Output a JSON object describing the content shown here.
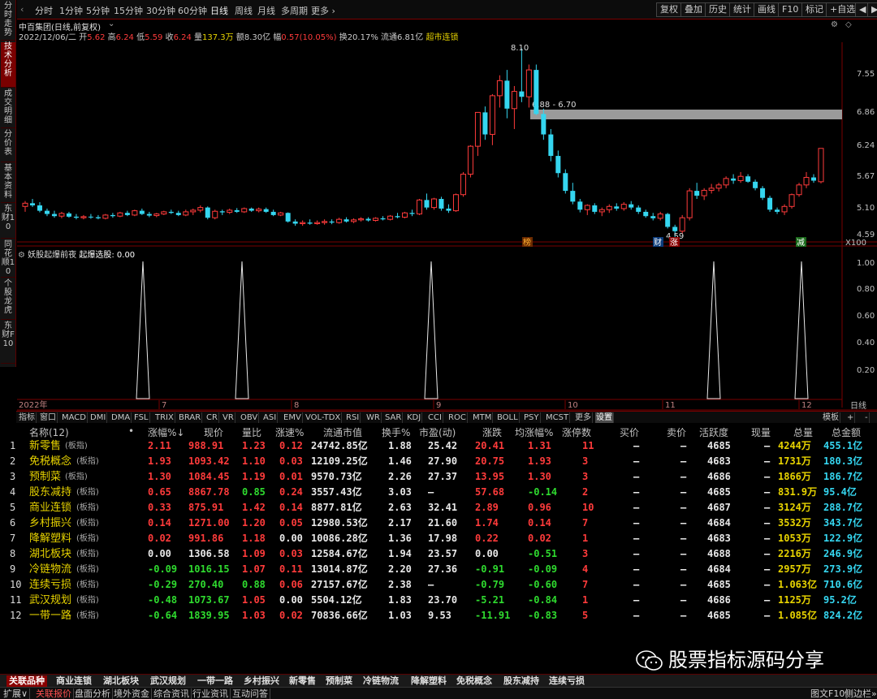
{
  "left_tabs": [
    "分时走势",
    "技术分析",
    "成交明细",
    "分价表",
    "基本资料",
    "东财10",
    "同花顺10",
    "个股龙虎",
    "东财F10"
  ],
  "periods": [
    "分时",
    "1分钟",
    "5分钟",
    "15分钟",
    "30分钟",
    "60分钟",
    "日线",
    "周线",
    "月线",
    "多周期",
    "更多 ›"
  ],
  "toolbar_right": [
    "复权",
    "叠加",
    "历史",
    "统计",
    "画线",
    "F10",
    "标记",
    "+自选",
    "◀",
    "▶"
  ],
  "stock": {
    "title": "中百集团(日线,前复权)",
    "date": "2022/12/06/二",
    "open_label": "开",
    "open": "5.62",
    "high_label": "高",
    "high": "6.24",
    "low_label": "低",
    "low": "5.59",
    "close_label": "收",
    "close": "6.24",
    "vol_label": "量",
    "vol": "137.3万",
    "amt_label": "额",
    "amt": "8.30亿",
    "chg_label": "幅",
    "chg": "0.57(10.05%)",
    "turn_label": "换",
    "turn": "20.17%",
    "float_label": "流通",
    "float": "6.81亿",
    "concept": "超市连锁"
  },
  "price_axis": [
    "7.55",
    "6.86",
    "6.24",
    "5.67",
    "5.10",
    "4.59",
    "X100"
  ],
  "annotations": {
    "high": "8.10",
    "zone": "6.88 - 6.70",
    "low": "4.59",
    "flag1": "榜",
    "flag2": "财",
    "flag3": "涨",
    "flag4": "减"
  },
  "candles": [
    [
      5.16,
      5.26,
      5.06,
      5.22
    ],
    [
      5.22,
      5.3,
      5.15,
      5.18
    ],
    [
      5.18,
      5.24,
      5.05,
      5.08
    ],
    [
      5.08,
      5.12,
      4.98,
      5.02
    ],
    [
      5.02,
      5.08,
      4.95,
      4.98
    ],
    [
      4.98,
      5.06,
      4.94,
      5.03
    ],
    [
      5.03,
      5.06,
      4.95,
      4.97
    ],
    [
      4.97,
      5.02,
      4.92,
      4.95
    ],
    [
      4.95,
      5.0,
      4.92,
      4.97
    ],
    [
      4.97,
      5.02,
      4.93,
      4.96
    ],
    [
      4.96,
      5.0,
      4.92,
      4.94
    ],
    [
      4.94,
      5.02,
      4.92,
      5.0
    ],
    [
      5.0,
      5.04,
      4.95,
      4.98
    ],
    [
      4.98,
      5.06,
      4.96,
      5.04
    ],
    [
      5.04,
      5.08,
      4.98,
      5.0
    ],
    [
      5.0,
      5.1,
      4.98,
      5.08
    ],
    [
      5.08,
      5.12,
      5.0,
      5.02
    ],
    [
      5.02,
      5.06,
      4.96,
      4.99
    ],
    [
      4.99,
      5.04,
      4.96,
      5.02
    ],
    [
      5.02,
      5.08,
      5.0,
      5.06
    ],
    [
      5.06,
      5.1,
      5.02,
      5.04
    ],
    [
      5.04,
      5.08,
      4.98,
      5.0
    ],
    [
      5.0,
      5.1,
      4.98,
      5.06
    ],
    [
      5.06,
      5.12,
      5.0,
      5.09
    ],
    [
      5.09,
      5.18,
      5.05,
      5.14
    ],
    [
      5.14,
      5.16,
      4.92,
      4.95
    ],
    [
      4.95,
      5.1,
      4.92,
      5.07
    ],
    [
      5.07,
      5.1,
      5.0,
      5.05
    ],
    [
      5.05,
      5.12,
      5.02,
      5.09
    ],
    [
      5.09,
      5.13,
      5.04,
      5.06
    ],
    [
      5.06,
      5.14,
      5.04,
      5.12
    ],
    [
      5.12,
      5.14,
      5.06,
      5.08
    ],
    [
      5.08,
      5.14,
      5.05,
      5.11
    ],
    [
      5.11,
      5.14,
      5.04,
      5.06
    ],
    [
      5.06,
      5.1,
      4.98,
      5.0
    ],
    [
      5.0,
      5.06,
      4.98,
      5.04
    ],
    [
      5.04,
      5.05,
      4.86,
      4.88
    ],
    [
      4.88,
      4.92,
      4.8,
      4.84
    ],
    [
      4.84,
      4.9,
      4.8,
      4.86
    ],
    [
      4.86,
      4.92,
      4.82,
      4.84
    ],
    [
      4.84,
      4.9,
      4.82,
      4.86
    ],
    [
      4.86,
      4.92,
      4.82,
      4.88
    ],
    [
      4.88,
      4.92,
      4.83,
      4.86
    ],
    [
      4.86,
      4.95,
      4.84,
      4.92
    ],
    [
      4.92,
      4.96,
      4.86,
      4.88
    ],
    [
      4.88,
      4.94,
      4.85,
      4.91
    ],
    [
      4.91,
      4.96,
      4.88,
      4.93
    ],
    [
      4.93,
      4.96,
      4.88,
      4.9
    ],
    [
      4.9,
      4.96,
      4.88,
      4.94
    ],
    [
      4.94,
      4.98,
      4.9,
      4.92
    ],
    [
      4.92,
      5.0,
      4.9,
      4.98
    ],
    [
      4.98,
      5.04,
      4.94,
      4.96
    ],
    [
      4.96,
      5.06,
      4.94,
      5.04
    ],
    [
      5.04,
      5.1,
      4.98,
      5.02
    ],
    [
      5.02,
      5.3,
      5.0,
      5.28
    ],
    [
      5.28,
      5.4,
      5.1,
      5.14
    ],
    [
      5.14,
      5.32,
      5.1,
      5.3
    ],
    [
      5.3,
      5.34,
      5.08,
      5.12
    ],
    [
      5.12,
      5.2,
      5.04,
      5.08
    ],
    [
      5.08,
      5.4,
      5.06,
      5.38
    ],
    [
      5.38,
      5.8,
      5.34,
      5.76
    ],
    [
      5.76,
      6.3,
      5.7,
      6.28
    ],
    [
      6.28,
      6.91,
      6.1,
      6.91
    ],
    [
      6.91,
      7.02,
      6.4,
      6.5
    ],
    [
      6.5,
      7.25,
      6.3,
      7.22
    ],
    [
      7.22,
      7.6,
      7.0,
      7.5
    ],
    [
      7.5,
      7.7,
      6.8,
      6.98
    ],
    [
      6.98,
      7.4,
      6.6,
      7.3
    ],
    [
      7.3,
      8.1,
      7.1,
      7.2
    ],
    [
      7.2,
      7.8,
      7.0,
      7.7
    ],
    [
      7.7,
      7.8,
      6.86,
      6.88
    ],
    [
      6.88,
      6.98,
      6.4,
      6.5
    ],
    [
      6.5,
      6.6,
      6.0,
      6.1
    ],
    [
      6.1,
      6.2,
      5.7,
      5.78
    ],
    [
      5.78,
      5.85,
      5.4,
      5.45
    ],
    [
      5.45,
      5.6,
      5.2,
      5.25
    ],
    [
      5.25,
      5.3,
      5.05,
      5.1
    ],
    [
      5.1,
      5.2,
      5.0,
      5.18
    ],
    [
      5.18,
      5.22,
      5.02,
      5.06
    ],
    [
      5.06,
      5.14,
      4.98,
      5.1
    ],
    [
      5.1,
      5.2,
      5.04,
      5.16
    ],
    [
      5.16,
      5.22,
      5.08,
      5.12
    ],
    [
      5.12,
      5.24,
      5.08,
      5.2
    ],
    [
      5.2,
      5.26,
      5.1,
      5.14
    ],
    [
      5.14,
      5.18,
      5.02,
      5.06
    ],
    [
      5.06,
      5.1,
      4.95,
      4.98
    ],
    [
      4.98,
      5.04,
      4.9,
      4.94
    ],
    [
      4.94,
      5.06,
      4.9,
      5.02
    ],
    [
      5.02,
      5.04,
      4.75,
      4.78
    ],
    [
      4.78,
      4.82,
      4.59,
      4.7
    ],
    [
      4.7,
      5.0,
      4.65,
      4.95
    ],
    [
      4.95,
      5.5,
      4.9,
      5.45
    ],
    [
      5.45,
      5.6,
      5.3,
      5.36
    ],
    [
      5.36,
      5.5,
      5.28,
      5.46
    ],
    [
      5.46,
      5.58,
      5.4,
      5.5
    ],
    [
      5.5,
      5.6,
      5.44,
      5.56
    ],
    [
      5.56,
      5.72,
      5.5,
      5.68
    ],
    [
      5.68,
      5.76,
      5.58,
      5.64
    ],
    [
      5.64,
      5.8,
      5.6,
      5.72
    ],
    [
      5.72,
      5.76,
      5.6,
      5.62
    ],
    [
      5.62,
      5.66,
      5.46,
      5.5
    ],
    [
      5.5,
      5.54,
      5.28,
      5.32
    ],
    [
      5.32,
      5.36,
      5.06,
      5.1
    ],
    [
      5.1,
      5.14,
      5.02,
      5.06
    ],
    [
      5.06,
      5.2,
      5.0,
      5.16
    ],
    [
      5.16,
      5.4,
      5.12,
      5.38
    ],
    [
      5.38,
      5.6,
      5.34,
      5.56
    ],
    [
      5.56,
      5.8,
      5.5,
      5.7
    ],
    [
      5.7,
      5.76,
      5.6,
      5.64
    ],
    [
      5.62,
      6.24,
      5.59,
      6.24
    ]
  ],
  "indicator": {
    "title": "妖股起爆前夜",
    "label": "起爆选股:",
    "value": "0.00",
    "axis": [
      "1.00",
      "0.80",
      "0.60",
      "0.40",
      "0.20"
    ]
  },
  "x_axis": [
    "2022年",
    "7",
    "8",
    "9",
    "10",
    "11",
    "12"
  ],
  "period_label": "日线",
  "ind_tabs": [
    "指标",
    "窗口",
    "MACD",
    "DMI",
    "DMA",
    "FSL",
    "TRIX",
    "BRAR",
    "CR",
    "VR",
    "OBV",
    "ASI",
    "EMV",
    "VOL-TDX",
    "RSI",
    "WR",
    "SAR",
    "KDJ",
    "CCI",
    "ROC",
    "MTM",
    "BOLL",
    "PSY",
    "MCST",
    "更多",
    "设置"
  ],
  "ind_tabs_right": [
    "模板",
    "+",
    "-"
  ],
  "table": {
    "headers": [
      "名称(12)",
      "•",
      "涨幅%↓",
      "现价",
      "量比",
      "涨速%",
      "流通市值",
      "换手%",
      "市盈(动)",
      "涨跌",
      "均涨幅%",
      "涨停数",
      "买价",
      "卖价",
      "活跃度",
      "现量",
      "总量",
      "总金额"
    ],
    "tag": "(板指)",
    "rows": [
      {
        "n": "1",
        "name": "新零售",
        "chg": "2.11",
        "price": "988.91",
        "vr": "1.23",
        "spd": "0.12",
        "mcap": "24742.85亿",
        "turn": "1.88",
        "pe": "25.42",
        "diff": "20.41",
        "avg": "1.31",
        "lim": "11",
        "buy": "—",
        "sell": "—",
        "act": "4685",
        "cur": "—",
        "vol": "4244万",
        "amt": "455.1亿",
        "c": "red",
        "pc": "red",
        "vc": "red",
        "sc": "red",
        "dc": "red",
        "ac": "red",
        "lc": "red"
      },
      {
        "n": "2",
        "name": "免税概念",
        "chg": "1.93",
        "price": "1093.42",
        "vr": "1.10",
        "spd": "0.03",
        "mcap": "12109.25亿",
        "turn": "1.46",
        "pe": "27.90",
        "diff": "20.75",
        "avg": "1.93",
        "lim": "3",
        "buy": "—",
        "sell": "—",
        "act": "4683",
        "cur": "—",
        "vol": "1731万",
        "amt": "180.3亿",
        "c": "red",
        "pc": "red",
        "vc": "red",
        "sc": "red",
        "dc": "red",
        "ac": "red",
        "lc": "red"
      },
      {
        "n": "3",
        "name": "预制菜",
        "chg": "1.30",
        "price": "1084.45",
        "vr": "1.19",
        "spd": "0.01",
        "mcap": "9570.73亿",
        "turn": "2.26",
        "pe": "27.37",
        "diff": "13.95",
        "avg": "1.30",
        "lim": "3",
        "buy": "—",
        "sell": "—",
        "act": "4686",
        "cur": "—",
        "vol": "1866万",
        "amt": "186.7亿",
        "c": "red",
        "pc": "red",
        "vc": "red",
        "sc": "red",
        "dc": "red",
        "ac": "red",
        "lc": "red"
      },
      {
        "n": "4",
        "name": "股东减持",
        "chg": "0.65",
        "price": "8867.78",
        "vr": "0.85",
        "spd": "0.24",
        "mcap": "3557.43亿",
        "turn": "3.03",
        "pe": "—",
        "diff": "57.68",
        "avg": "-0.14",
        "lim": "2",
        "buy": "—",
        "sell": "—",
        "act": "4685",
        "cur": "—",
        "vol": "831.9万",
        "amt": "95.4亿",
        "c": "red",
        "pc": "red",
        "vc": "green",
        "sc": "red",
        "dc": "red",
        "ac": "green",
        "lc": "red"
      },
      {
        "n": "5",
        "name": "商业连锁",
        "chg": "0.33",
        "price": "875.91",
        "vr": "1.42",
        "spd": "0.14",
        "mcap": "8877.81亿",
        "turn": "2.63",
        "pe": "32.41",
        "diff": "2.89",
        "avg": "0.96",
        "lim": "10",
        "buy": "—",
        "sell": "—",
        "act": "4687",
        "cur": "—",
        "vol": "3124万",
        "amt": "288.7亿",
        "c": "red",
        "pc": "red",
        "vc": "red",
        "sc": "red",
        "dc": "red",
        "ac": "red",
        "lc": "red"
      },
      {
        "n": "6",
        "name": "乡村振兴",
        "chg": "0.14",
        "price": "1271.00",
        "vr": "1.20",
        "spd": "0.05",
        "mcap": "12980.53亿",
        "turn": "2.17",
        "pe": "21.60",
        "diff": "1.74",
        "avg": "0.14",
        "lim": "7",
        "buy": "—",
        "sell": "—",
        "act": "4684",
        "cur": "—",
        "vol": "3532万",
        "amt": "343.7亿",
        "c": "red",
        "pc": "red",
        "vc": "red",
        "sc": "red",
        "dc": "red",
        "ac": "red",
        "lc": "red"
      },
      {
        "n": "7",
        "name": "降解塑料",
        "chg": "0.02",
        "price": "991.86",
        "vr": "1.18",
        "spd": "0.00",
        "mcap": "10086.28亿",
        "turn": "1.36",
        "pe": "17.98",
        "diff": "0.22",
        "avg": "0.02",
        "lim": "1",
        "buy": "—",
        "sell": "—",
        "act": "4683",
        "cur": "—",
        "vol": "1053万",
        "amt": "122.9亿",
        "c": "red",
        "pc": "red",
        "vc": "red",
        "sc": "white",
        "dc": "red",
        "ac": "red",
        "lc": "red"
      },
      {
        "n": "8",
        "name": "湖北板块",
        "chg": "0.00",
        "price": "1306.58",
        "vr": "1.09",
        "spd": "0.03",
        "mcap": "12584.67亿",
        "turn": "1.94",
        "pe": "23.57",
        "diff": "0.00",
        "avg": "-0.51",
        "lim": "3",
        "buy": "—",
        "sell": "—",
        "act": "4688",
        "cur": "—",
        "vol": "2216万",
        "amt": "246.9亿",
        "c": "white",
        "pc": "white",
        "vc": "red",
        "sc": "red",
        "dc": "white",
        "ac": "green",
        "lc": "red"
      },
      {
        "n": "9",
        "name": "冷链物流",
        "chg": "-0.09",
        "price": "1016.15",
        "vr": "1.07",
        "spd": "0.11",
        "mcap": "13014.87亿",
        "turn": "2.20",
        "pe": "27.36",
        "diff": "-0.91",
        "avg": "-0.09",
        "lim": "4",
        "buy": "—",
        "sell": "—",
        "act": "4684",
        "cur": "—",
        "vol": "2957万",
        "amt": "273.9亿",
        "c": "green",
        "pc": "green",
        "vc": "red",
        "sc": "red",
        "dc": "green",
        "ac": "green",
        "lc": "red"
      },
      {
        "n": "10",
        "name": "连续亏损",
        "chg": "-0.29",
        "price": "270.40",
        "vr": "0.88",
        "spd": "0.06",
        "mcap": "27157.67亿",
        "turn": "2.38",
        "pe": "—",
        "diff": "-0.79",
        "avg": "-0.60",
        "lim": "7",
        "buy": "—",
        "sell": "—",
        "act": "4685",
        "cur": "—",
        "vol": "1.063亿",
        "amt": "710.6亿",
        "c": "green",
        "pc": "green",
        "vc": "green",
        "sc": "red",
        "dc": "green",
        "ac": "green",
        "lc": "red"
      },
      {
        "n": "11",
        "name": "武汉规划",
        "chg": "-0.48",
        "price": "1073.67",
        "vr": "1.05",
        "spd": "0.00",
        "mcap": "5504.12亿",
        "turn": "1.83",
        "pe": "23.70",
        "diff": "-5.21",
        "avg": "-0.84",
        "lim": "1",
        "buy": "—",
        "sell": "—",
        "act": "4686",
        "cur": "—",
        "vol": "1125万",
        "amt": "95.2亿",
        "c": "green",
        "pc": "green",
        "vc": "red",
        "sc": "white",
        "dc": "green",
        "ac": "green",
        "lc": "red"
      },
      {
        "n": "12",
        "name": "一带一路",
        "chg": "-0.64",
        "price": "1839.95",
        "vr": "1.03",
        "spd": "0.02",
        "mcap": "70836.66亿",
        "turn": "1.03",
        "pe": "9.53",
        "diff": "-11.91",
        "avg": "-0.83",
        "lim": "5",
        "buy": "—",
        "sell": "—",
        "act": "4685",
        "cur": "—",
        "vol": "1.085亿",
        "amt": "824.2亿",
        "c": "green",
        "pc": "green",
        "vc": "red",
        "sc": "red",
        "dc": "green",
        "ac": "green",
        "lc": "red"
      }
    ]
  },
  "watermark": "股票指标源码分享",
  "sector_tabs": [
    "关联品种",
    "商业连锁",
    "湖北板块",
    "武汉规划",
    "一带一路",
    "乡村振兴",
    "新零售",
    "预制菜",
    "冷链物流",
    "降解塑料",
    "免税概念",
    "股东减持",
    "连续亏损"
  ],
  "status": [
    "扩展∨",
    "关联报价",
    "盘面分析",
    "境外资金",
    "综合资讯",
    "行业资讯",
    "互动问答"
  ],
  "status_right": [
    "图文F10",
    "侧边栏»"
  ],
  "colors": {
    "up": "#ff3b3b",
    "down": "#35d6f0",
    "accent": "#7a0000"
  }
}
